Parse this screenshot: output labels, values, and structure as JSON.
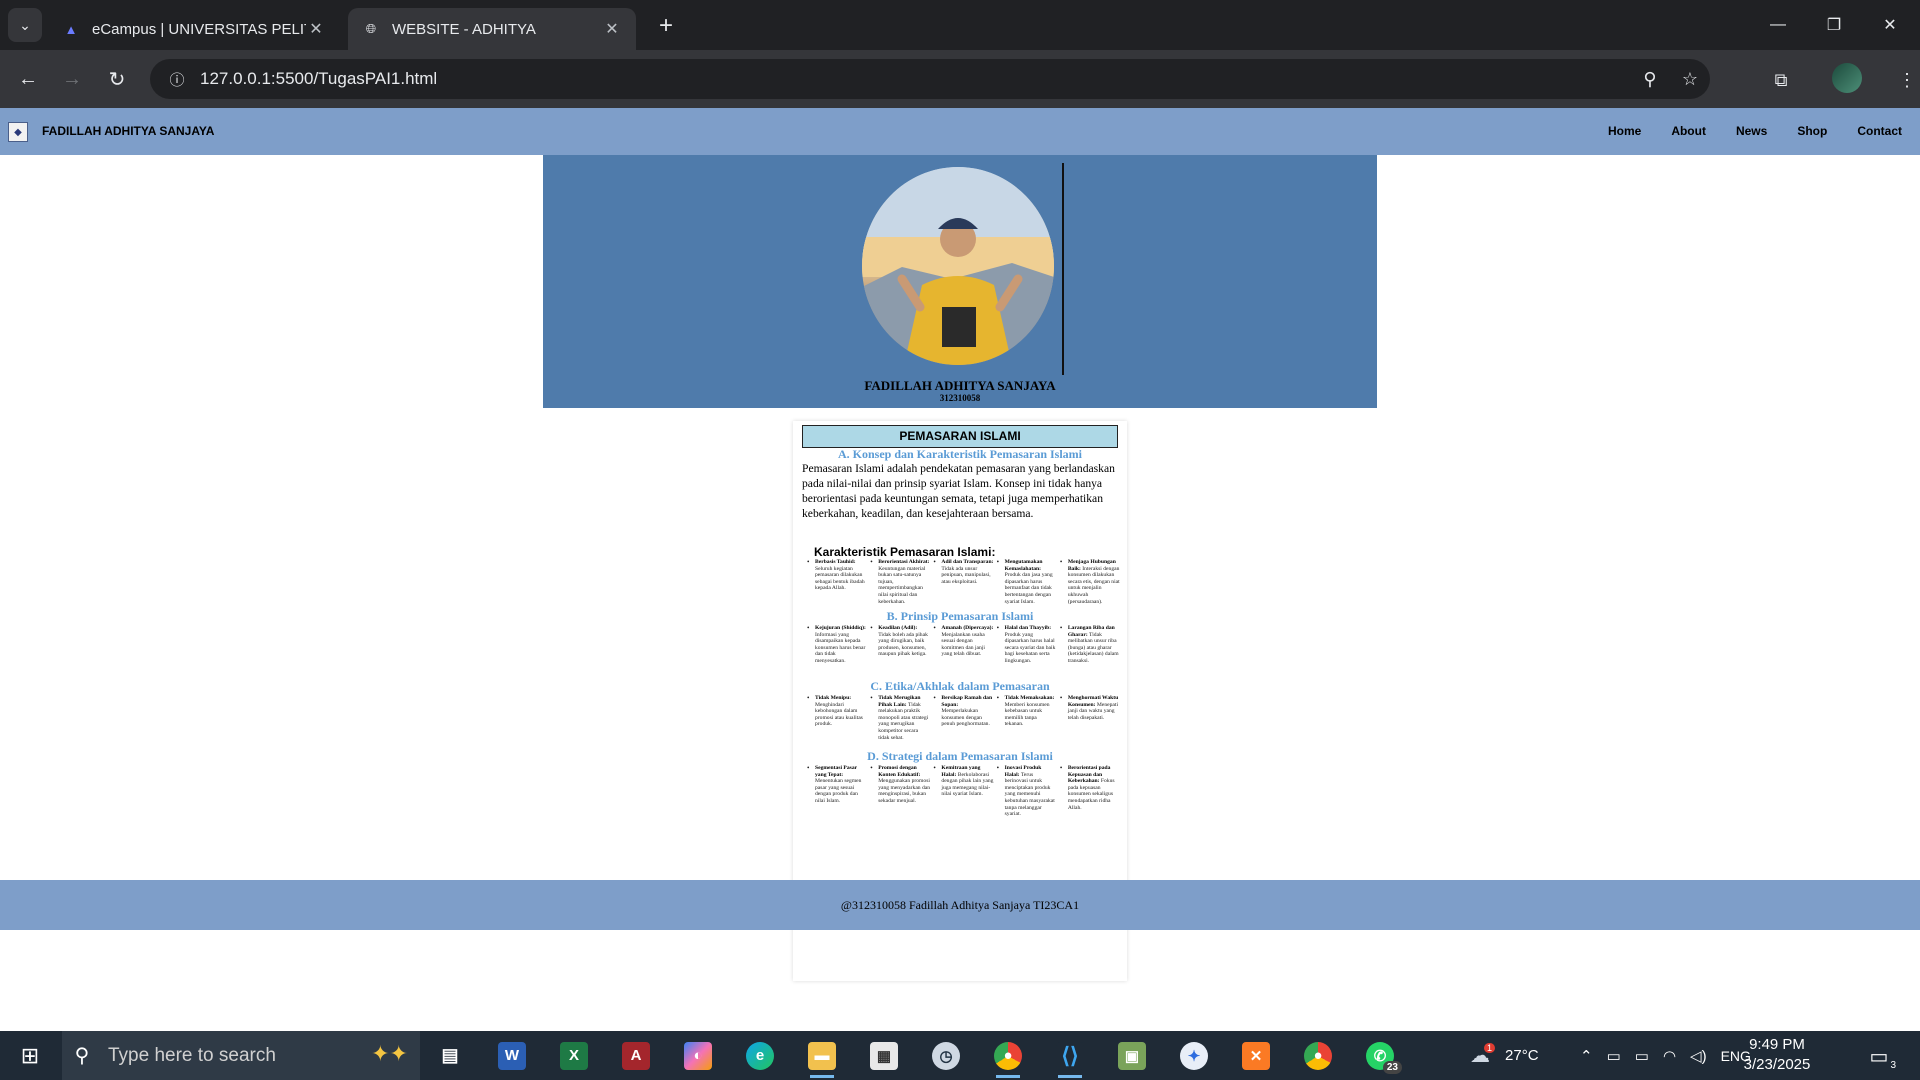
{
  "browser": {
    "tabs": [
      {
        "title": "eCampus | UNIVERSITAS PELITA",
        "active": false
      },
      {
        "title": "WEBSITE - ADHITYA",
        "active": true
      }
    ],
    "url": "127.0.0.1:5500/TugasPAI1.html"
  },
  "site": {
    "brand": "FADILLAH ADHITYA SANJAYA",
    "menu": [
      "Home",
      "About",
      "News",
      "Shop",
      "Contact"
    ],
    "hero": {
      "name": "FADILLAH ADHITYA SANJAYA",
      "nim": "312310058"
    },
    "card": {
      "title": "PEMASARAN ISLAMI",
      "section_a": "A. Konsep dan Karakteristik Pemasaran Islami",
      "intro": "Pemasaran Islami adalah pendekatan pemasaran yang berlandaskan pada nilai-nilai dan prinsip syariat Islam. Konsep ini tidak hanya berorientasi pada keuntungan semata, tetapi juga memperhatikan keberkahan, keadilan, dan kesejahteraan bersama.",
      "karakteristik_heading": "Karakteristik Pemasaran Islami:",
      "karakteristik": [
        {
          "term": "Berbasis Tauhid:",
          "desc": "Seluruh kegiatan pemasaran dilakukan sebagai bentuk ibadah kepada Allah."
        },
        {
          "term": "Berorientasi Akhirat:",
          "desc": "Keuntungan material bukan satu-satunya tujuan, mempertimbangkan nilai spiritual dan keberkahan."
        },
        {
          "term": "Adil dan Transparan:",
          "desc": "Tidak ada unsur penipuan, manipulasi, atau eksploitasi."
        },
        {
          "term": "Mengutamakan Kemaslahatan:",
          "desc": "Produk dan jasa yang dipasarkan harus bermanfaat dan tidak bertentangan dengan syariat Islam."
        },
        {
          "term": "Menjaga Hubungan Baik:",
          "desc": "Interaksi dengan konsumen dilakukan secara etis, dengan niat untuk menjalin ukhuwah (persaudaraan)."
        }
      ],
      "section_b": "B. Prinsip Pemasaran Islami",
      "prinsip": [
        {
          "term": "Kejujuran (Shiddiq):",
          "desc": "Informasi yang disampaikan kepada konsumen harus benar dan tidak menyesatkan."
        },
        {
          "term": "Keadilan (Adil):",
          "desc": "Tidak boleh ada pihak yang dirugikan, baik produsen, konsumen, maupun pihak ketiga."
        },
        {
          "term": "Amanah (Dipercaya):",
          "desc": "Menjalankan usaha sesuai dengan komitmen dan janji yang telah dibuat."
        },
        {
          "term": "Halal dan Thayyib:",
          "desc": "Produk yang dipasarkan harus halal secara syariat dan baik bagi kesehatan serta lingkungan."
        },
        {
          "term": "Larangan Riba dan Gharar:",
          "desc": "Tidak melibatkan unsur riba (bunga) atau gharar (ketidakjelasan) dalam transaksi."
        }
      ],
      "section_c": "C. Etika/Akhlak dalam Pemasaran",
      "etika": [
        {
          "term": "Tidak Menipu:",
          "desc": "Menghindari kebohongan dalam promosi atau kualitas produk."
        },
        {
          "term": "Tidak Merugikan Pihak Lain:",
          "desc": "Tidak melakukan praktik monopoli atau strategi yang merugikan kompetitor secara tidak sehat."
        },
        {
          "term": "Bersikap Ramah dan Sopan:",
          "desc": "Memperlakukan konsumen dengan penuh penghormatan."
        },
        {
          "term": "Tidak Memaksakan:",
          "desc": "Memberi konsumen kebebasan untuk memilih tanpa tekanan."
        },
        {
          "term": "Menghormati Waktu Konsumen:",
          "desc": "Menepati janji dan waktu yang telah disepakati."
        }
      ],
      "section_d": "D. Strategi dalam Pemasaran Islami",
      "strategi": [
        {
          "term": "Segmentasi Pasar yang Tepat:",
          "desc": "Menentukan segmen pasar yang sesuai dengan produk dan nilai Islam."
        },
        {
          "term": "Promosi dengan Konten Edukatif:",
          "desc": "Menggunakan promosi yang menyadarkan dan menginspirasi, bukan sekadar menjual."
        },
        {
          "term": "Kemitraan yang Halal:",
          "desc": "Berkolaborasi dengan pihak lain yang juga memegang nilai-nilai syariat Islam."
        },
        {
          "term": "Inovasi Produk Halal:",
          "desc": "Terus berinovasi untuk menciptakan produk yang memenuhi kebutuhan masyarakat tanpa melanggar syariat."
        },
        {
          "term": "Berorientasi pada Kepuasan dan Keberkahan:",
          "desc": "Fokus pada kepuasan konsumen sekaligus mendapatkan ridha Allah."
        }
      ]
    },
    "footer": "@312310058 Fadillah Adhitya Sanjaya TI23CA1"
  },
  "taskbar": {
    "search_placeholder": "Type here to search",
    "weather": "27°C",
    "language": "ENG",
    "time": "9:49 PM",
    "date": "3/23/2025",
    "whatsapp_badge": "23",
    "notification_badge": "3",
    "weather_badge": "1"
  },
  "colors": {
    "nav": "#7e9ec9",
    "hero": "#4f7bab",
    "section_heading": "#5a9bd5",
    "card_title_bg": "#add8e6"
  }
}
